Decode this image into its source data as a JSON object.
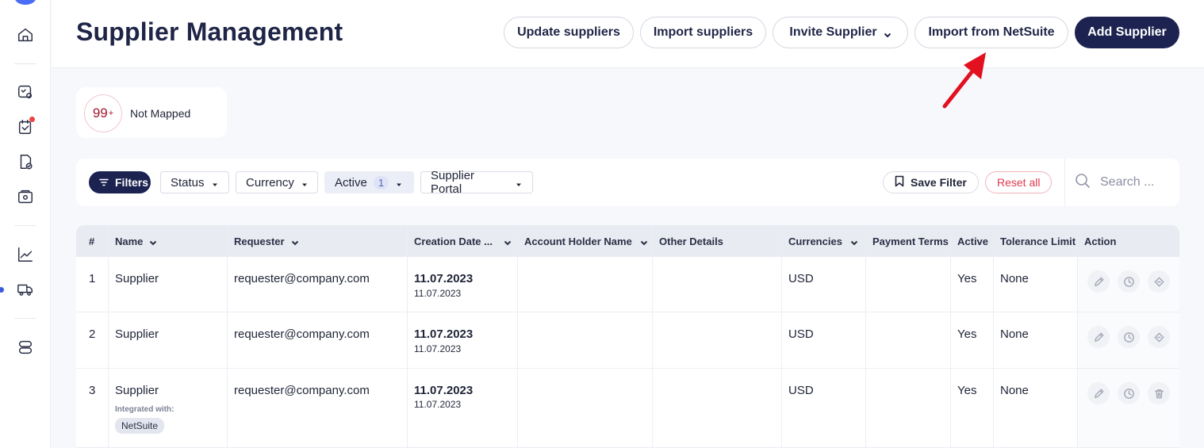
{
  "header": {
    "title": "Supplier Management",
    "buttons": {
      "update": "Update suppliers",
      "import": "Import suppliers",
      "invite": "Invite Supplier",
      "netsuite": "Import from NetSuite",
      "add": "Add Supplier"
    }
  },
  "stat": {
    "count": "99",
    "plus": "+",
    "label": "Not Mapped"
  },
  "filters": {
    "filters_label": "Filters",
    "status": "Status",
    "currency": "Currency",
    "active": "Active",
    "active_count": "1",
    "portal": "Supplier Portal",
    "save_filter": "Save Filter",
    "reset_all": "Reset all",
    "search_placeholder": "Search ..."
  },
  "table": {
    "columns": {
      "num": "#",
      "name": "Name",
      "requester": "Requester",
      "creation_date": "Creation Date ...",
      "account_holder": "Account Holder Name",
      "other_details": "Other Details",
      "currencies": "Currencies",
      "payment_terms": "Payment Terms",
      "active": "Active",
      "tolerance": "Tolerance Limit",
      "action": "Action"
    },
    "rows": [
      {
        "num": "1",
        "name": "Supplier",
        "requester": "requester@company.com",
        "date": "11.07.2023",
        "date_sub": "11.07.2023",
        "currency": "USD",
        "active": "Yes",
        "tolerance": "None"
      },
      {
        "num": "2",
        "name": "Supplier",
        "requester": "requester@company.com",
        "date": "11.07.2023",
        "date_sub": "11.07.2023",
        "currency": "USD",
        "active": "Yes",
        "tolerance": "None"
      },
      {
        "num": "3",
        "name": "Supplier",
        "integrated_label": "Integrated with:",
        "integrated_tag": "NetSuite",
        "requester": "requester@company.com",
        "date": "11.07.2023",
        "date_sub": "11.07.2023",
        "currency": "USD",
        "active": "Yes",
        "tolerance": "None"
      }
    ]
  },
  "colors": {
    "primary": "#1c2350",
    "accent_red": "#e0394f",
    "annotation": "#e3101f"
  },
  "icons": [
    "home-icon",
    "assessment-icon",
    "checklist-icon",
    "document-check-icon",
    "wallet-icon",
    "chart-icon",
    "truck-icon",
    "server-icon",
    "edit-icon",
    "history-icon",
    "restore-icon",
    "trash-icon",
    "search-icon",
    "bookmark-icon",
    "filter-icon",
    "chevron-down-icon"
  ]
}
